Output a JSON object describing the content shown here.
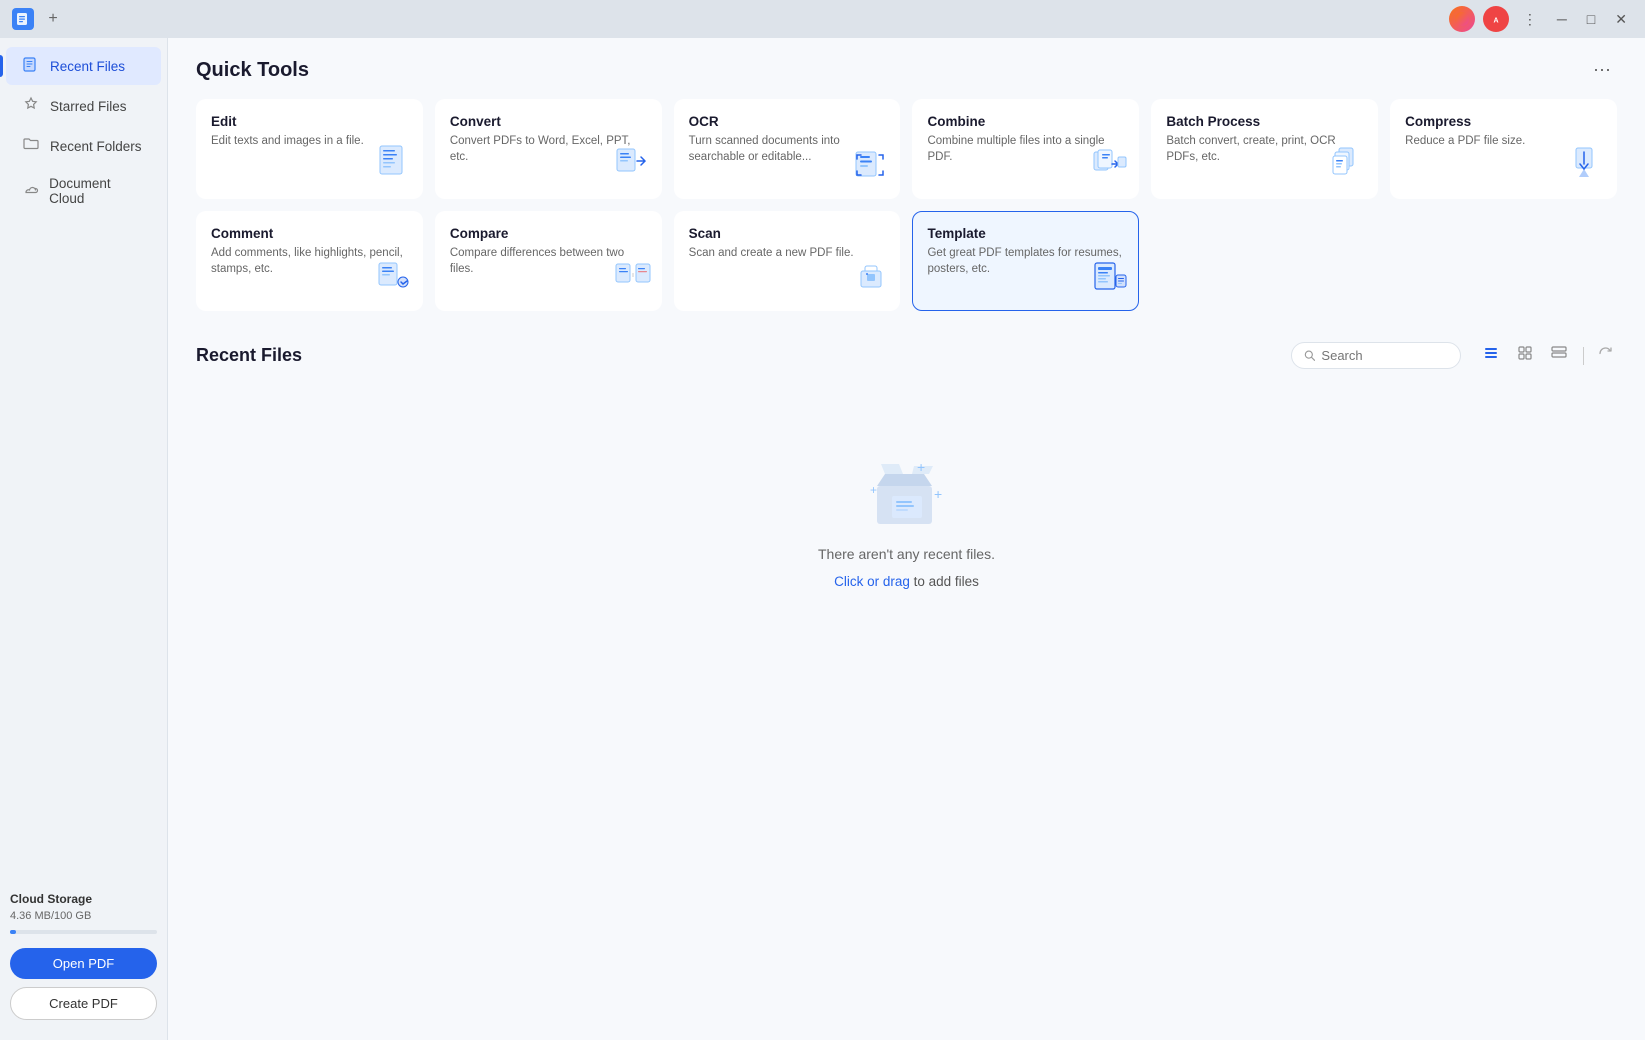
{
  "titlebar": {
    "new_tab_label": "+",
    "menu_icon": "⋮",
    "minimize": "─",
    "maximize": "□",
    "close": "✕"
  },
  "sidebar": {
    "items": [
      {
        "id": "recent-files",
        "label": "Recent Files",
        "icon": "🕐",
        "active": true
      },
      {
        "id": "starred-files",
        "label": "Starred Files",
        "icon": "☆",
        "active": false
      },
      {
        "id": "recent-folders",
        "label": "Recent Folders",
        "icon": "📁",
        "active": false
      },
      {
        "id": "document-cloud",
        "label": "Document Cloud",
        "icon": "☁",
        "active": false
      }
    ],
    "cloud_storage": {
      "label": "Cloud Storage",
      "value": "4.36 MB/100 GB"
    },
    "open_pdf_label": "Open PDF",
    "create_pdf_label": "Create PDF"
  },
  "quick_tools": {
    "title": "Quick Tools",
    "more_icon": "⋯",
    "tools": [
      {
        "id": "edit",
        "title": "Edit",
        "desc": "Edit texts and images in a file."
      },
      {
        "id": "convert",
        "title": "Convert",
        "desc": "Convert PDFs to Word, Excel, PPT, etc."
      },
      {
        "id": "ocr",
        "title": "OCR",
        "desc": "Turn scanned documents into searchable or editable..."
      },
      {
        "id": "combine",
        "title": "Combine",
        "desc": "Combine multiple files into a single PDF."
      },
      {
        "id": "batch-process",
        "title": "Batch Process",
        "desc": "Batch convert, create, print, OCR PDFs, etc."
      },
      {
        "id": "compress",
        "title": "Compress",
        "desc": "Reduce a PDF file size."
      },
      {
        "id": "comment",
        "title": "Comment",
        "desc": "Add comments, like highlights, pencil, stamps, etc."
      },
      {
        "id": "compare",
        "title": "Compare",
        "desc": "Compare differences between two files."
      },
      {
        "id": "scan",
        "title": "Scan",
        "desc": "Scan and create a new PDF file."
      },
      {
        "id": "template",
        "title": "Template",
        "desc": "Get great PDF templates for resumes, posters, etc.",
        "selected": true
      }
    ]
  },
  "recent_files": {
    "title": "Recent Files",
    "search_placeholder": "Search",
    "empty_message": "There aren't any recent files.",
    "click_or_drag": "Click or drag",
    "to_add_files": " to add files"
  }
}
